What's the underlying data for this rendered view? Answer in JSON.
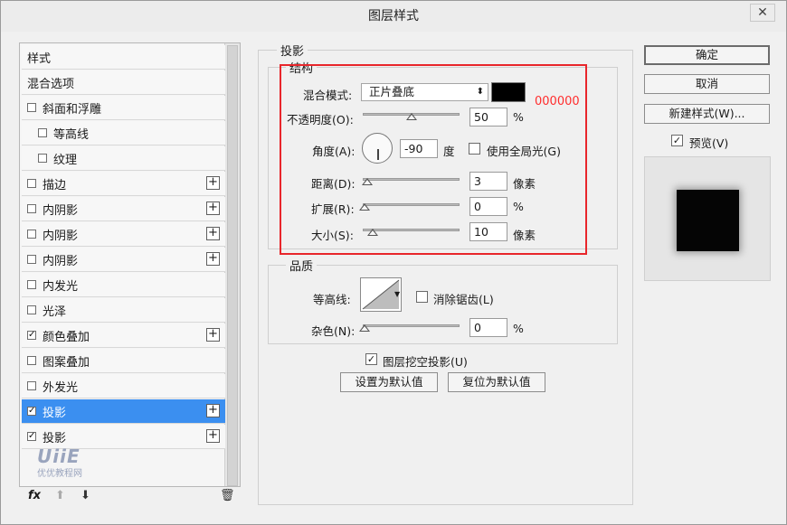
{
  "window": {
    "title": "图层样式",
    "close": "✕"
  },
  "left_list": {
    "items": [
      {
        "label": "样式",
        "check": false,
        "has_check": false,
        "plus": false,
        "indent": 0
      },
      {
        "label": "混合选项",
        "check": false,
        "has_check": false,
        "plus": false,
        "indent": 0
      },
      {
        "label": "斜面和浮雕",
        "check": false,
        "has_check": true,
        "plus": false,
        "indent": 0
      },
      {
        "label": "等高线",
        "check": false,
        "has_check": true,
        "plus": false,
        "indent": 1
      },
      {
        "label": "纹理",
        "check": false,
        "has_check": true,
        "plus": false,
        "indent": 1
      },
      {
        "label": "描边",
        "check": false,
        "has_check": true,
        "plus": true,
        "indent": 0
      },
      {
        "label": "内阴影",
        "check": false,
        "has_check": true,
        "plus": true,
        "indent": 0
      },
      {
        "label": "内阴影",
        "check": false,
        "has_check": true,
        "plus": true,
        "indent": 0
      },
      {
        "label": "内阴影",
        "check": false,
        "has_check": true,
        "plus": true,
        "indent": 0
      },
      {
        "label": "内发光",
        "check": false,
        "has_check": true,
        "plus": false,
        "indent": 0
      },
      {
        "label": "光泽",
        "check": false,
        "has_check": true,
        "plus": false,
        "indent": 0
      },
      {
        "label": "颜色叠加",
        "check": true,
        "has_check": true,
        "plus": true,
        "indent": 0
      },
      {
        "label": "图案叠加",
        "check": false,
        "has_check": true,
        "plus": false,
        "indent": 0
      },
      {
        "label": "外发光",
        "check": false,
        "has_check": true,
        "plus": false,
        "indent": 0
      },
      {
        "label": "投影",
        "check": true,
        "has_check": true,
        "plus": true,
        "indent": 0,
        "selected": true
      },
      {
        "label": "投影",
        "check": true,
        "has_check": true,
        "plus": true,
        "indent": 0
      }
    ],
    "check_mark": "✓",
    "plus_mark": "+",
    "footer": {
      "fx": "fx",
      "up": "⬆",
      "down": "⬇",
      "trash": "🗑"
    }
  },
  "watermark": {
    "logo": "UiiE",
    "sub": "优优教程网"
  },
  "shadow_panel": {
    "group_title": "投影",
    "structure": {
      "title": "结构",
      "blend_mode_label": "混合模式:",
      "blend_mode_value": "正片叠底",
      "color_hex_note": "000000",
      "opacity_label": "不透明度(O):",
      "opacity_value": "50",
      "opacity_unit": "%",
      "opacity_fraction": 0.5,
      "angle_label": "角度(A):",
      "angle_value": "-90",
      "angle_unit": "度",
      "global_light_label": "使用全局光(G)",
      "distance_label": "距离(D):",
      "distance_value": "3",
      "distance_unit": "像素",
      "spread_label": "扩展(R):",
      "spread_value": "0",
      "spread_unit": "%",
      "size_label": "大小(S):",
      "size_value": "10",
      "size_unit": "像素"
    },
    "quality": {
      "title": "品质",
      "contour_label": "等高线:",
      "antialias_label": "消除锯齿(L)",
      "noise_label": "杂色(N):",
      "noise_value": "0",
      "noise_unit": "%"
    },
    "knockout_label": "图层挖空投影(U)",
    "set_default": "设置为默认值",
    "reset_default": "复位为默认值"
  },
  "right_panel": {
    "ok": "确定",
    "cancel": "取消",
    "new_style": "新建样式(W)...",
    "preview_label": "预览(V)",
    "preview_checked": true
  },
  "colors": {
    "selection": "#3b8ff0",
    "highlight_box": "#e8262b",
    "hex_note": "#ff2d2d",
    "shadow_color": "#000000"
  }
}
